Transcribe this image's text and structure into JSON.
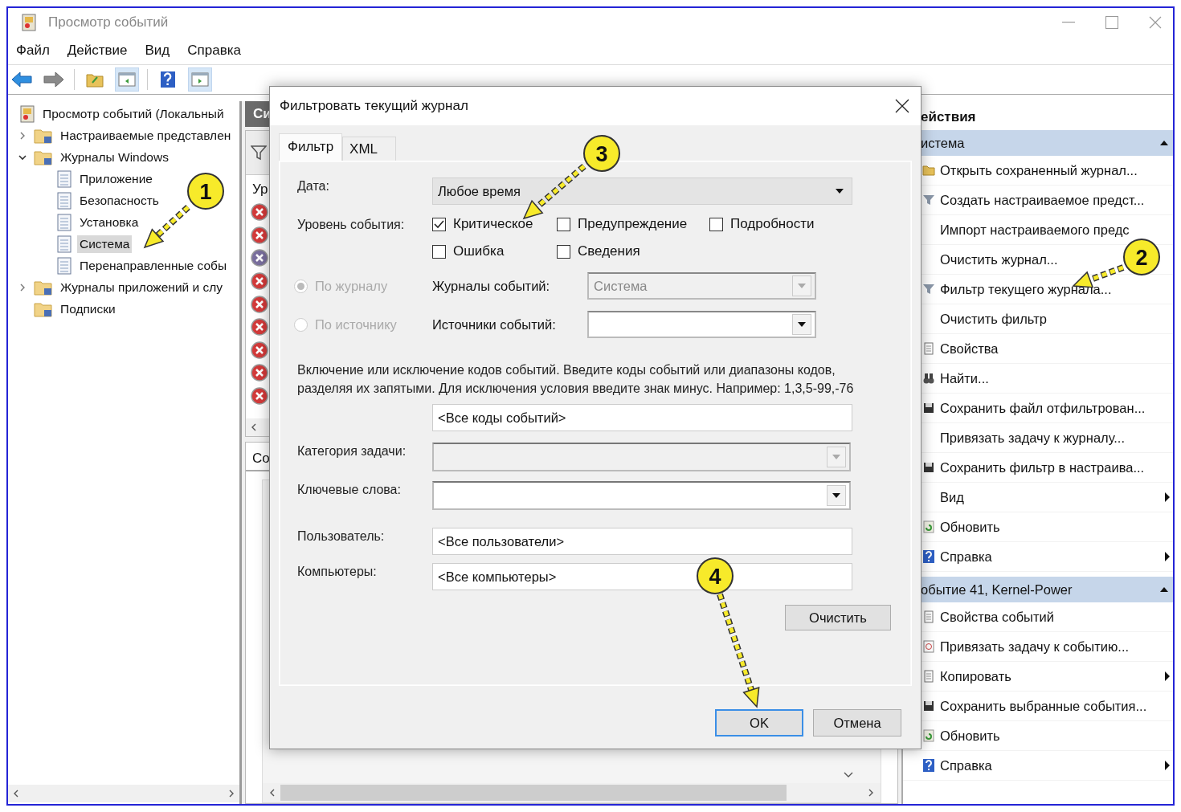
{
  "window": {
    "title": "Просмотр событий"
  },
  "menu": [
    "Файл",
    "Действие",
    "Вид",
    "Справка"
  ],
  "tree": [
    {
      "label": "Просмотр событий (Локальный",
      "selected": false,
      "children": [
        {
          "label": "Настраиваемые представлен",
          "selected": false,
          "expanded": false
        },
        {
          "label": "Журналы Windows",
          "selected": false,
          "expanded": true,
          "children": [
            {
              "label": "Приложение",
              "selected": false
            },
            {
              "label": "Безопасность",
              "selected": false
            },
            {
              "label": "Установка",
              "selected": false
            },
            {
              "label": "Система",
              "selected": true
            },
            {
              "label": "Перенаправленные собы",
              "selected": false
            }
          ]
        },
        {
          "label": "Журналы приложений и слу",
          "selected": false,
          "expanded": false
        },
        {
          "label": "Подписки",
          "selected": false
        }
      ]
    }
  ],
  "middle": {
    "header": "Си",
    "column": "Ур",
    "events": [
      {
        "selected": false
      },
      {
        "selected": false
      },
      {
        "selected": true
      },
      {
        "selected": false
      },
      {
        "selected": false
      },
      {
        "selected": false
      },
      {
        "selected": false
      },
      {
        "selected": false
      },
      {
        "selected": false
      }
    ],
    "lower_tab": "Со"
  },
  "actions": {
    "title": "ействия",
    "sections": [
      {
        "title": "истема",
        "items": [
          {
            "label": "Открыть сохраненный журнал...",
            "submenu": false
          },
          {
            "label": "Создать настраиваемое предст...",
            "submenu": false
          },
          {
            "label": "Импорт настраиваемого предс",
            "submenu": false
          },
          {
            "label": "Очистить журнал...",
            "submenu": false
          },
          {
            "label": "Фильтр текущего журнала...",
            "submenu": false
          },
          {
            "label": "Очистить фильтр",
            "submenu": false
          },
          {
            "label": "Свойства",
            "submenu": false
          },
          {
            "label": "Найти...",
            "submenu": false
          },
          {
            "label": "Сохранить файл отфильтрован...",
            "submenu": false
          },
          {
            "label": "Привязать задачу к журналу...",
            "submenu": false
          },
          {
            "label": "Сохранить фильтр в настраива...",
            "submenu": false
          },
          {
            "label": "Вид",
            "submenu": true
          },
          {
            "label": "Обновить",
            "submenu": false
          },
          {
            "label": "Справка",
            "submenu": true
          }
        ]
      },
      {
        "title": "обытие 41, Kernel-Power",
        "items": [
          {
            "label": "Свойства событий",
            "submenu": false
          },
          {
            "label": "Привязать задачу к событию...",
            "submenu": false
          },
          {
            "label": "Копировать",
            "submenu": true
          },
          {
            "label": "Сохранить выбранные события...",
            "submenu": false
          },
          {
            "label": "Обновить",
            "submenu": false
          },
          {
            "label": "Справка",
            "submenu": true
          }
        ]
      }
    ]
  },
  "dialog": {
    "title": "Фильтровать текущий журнал",
    "tabs": [
      {
        "label": "Фильтр",
        "selected": true
      },
      {
        "label": "XML",
        "selected": false
      }
    ],
    "date": {
      "label": "Дата:",
      "value": "Любое время"
    },
    "level_label": "Уровень события:",
    "levels": [
      {
        "label": "Критическое",
        "checked": true
      },
      {
        "label": "Предупреждение",
        "checked": false
      },
      {
        "label": "Подробности",
        "checked": false
      },
      {
        "label": "Ошибка",
        "checked": false
      },
      {
        "label": "Сведения",
        "checked": false
      }
    ],
    "scope": [
      {
        "label": "По журналу",
        "selected": true,
        "disabled": true,
        "field_label": "Журналы событий:",
        "combo": {
          "value": "Система",
          "disabled": true
        }
      },
      {
        "label": "По источнику",
        "selected": false,
        "disabled": true,
        "field_label": "Источники событий:",
        "combo": {
          "disabled": false
        }
      }
    ],
    "ids_hint": "Включение или исключение кодов событий. Введите коды событий или диапазоны кодов, разделяя их запятыми. Для исключения условия введите знак минус. Например: 1,3,5-99,-76",
    "ids_value": "<Все коды событий>",
    "task_category": {
      "label": "Категория задачи:",
      "disabled": true
    },
    "keywords": {
      "label": "Ключевые слова:",
      "disabled": false
    },
    "user": {
      "label": "Пользователь:",
      "value": "<Все пользователи>"
    },
    "computers": {
      "label": "Компьютеры:",
      "value": "<Все компьютеры>"
    },
    "clear_button": "Очистить",
    "buttons": [
      {
        "label": "OK",
        "default": true
      },
      {
        "label": "Отмена",
        "default": false
      }
    ]
  },
  "callouts": [
    {
      "number": "1"
    },
    {
      "number": "2"
    },
    {
      "number": "3"
    },
    {
      "number": "4"
    }
  ]
}
